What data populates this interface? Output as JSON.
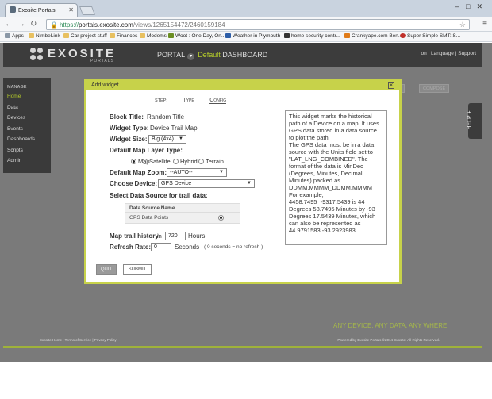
{
  "browser": {
    "tab_title": "Exosite Portals",
    "url_host": "portals.exosite.com",
    "url_path": "/views/1265154472/2460159184",
    "url_scheme": "https://",
    "bookmarks": [
      "Apps",
      "NimbeLink",
      "Car project stuff",
      "Finances",
      "Modems",
      "Woot : One Day, On...",
      "Weather in Plymouth",
      "home security contr...",
      "Crankyape.com Ben...",
      "Super Simple SMT: S..."
    ]
  },
  "header": {
    "logo_text": "EXOSITE",
    "logo_sub": "PORTALS",
    "portal_label": "PORTAL",
    "default_label": "Default",
    "dashboard_label": "DASHBOARD",
    "right_user": "on",
    "right_language": "| Language",
    "right_support": "| Support"
  },
  "sidebar": {
    "section": "MANAGE",
    "items": [
      {
        "label": "Home",
        "active": true
      },
      {
        "label": "Data"
      },
      {
        "label": "Devices"
      },
      {
        "label": "Events"
      },
      {
        "label": "Dashboards"
      },
      {
        "label": "Scripts"
      },
      {
        "label": "Admin"
      }
    ]
  },
  "background_buttons": {
    "compose": "COMPOSE"
  },
  "help_tab": "HELP +",
  "tagline": "ANY DEVICE. ANY DATA. ANY WHERE.",
  "footer": {
    "left": "Exosite Home | Terms of Service | Privacy Policy",
    "right": "Powered by Exosite Portals ©2014 Exosite. All Rights Reserved."
  },
  "modal": {
    "title": "Add widget",
    "step_label": "STEP:",
    "steps": [
      {
        "label": "Type"
      },
      {
        "label": "Config",
        "active": true
      }
    ],
    "block_title_label": "Block Title:",
    "block_title_value": "Random Title",
    "widget_type_label": "Widget Type:",
    "widget_type_value": "Device Trail Map",
    "widget_size_label": "Widget Size:",
    "widget_size_value": "Big (4x4)",
    "map_layer_label": "Default Map Layer Type:",
    "map_layers": [
      {
        "label": "Map",
        "selected": true
      },
      {
        "label": "Satellite"
      },
      {
        "label": "Hybrid"
      },
      {
        "label": "Terrain"
      }
    ],
    "map_zoom_label": "Default Map Zoom:",
    "map_zoom_value": "--AUTO--",
    "device_label": "Choose Device:",
    "device_value": "GPS Device",
    "datasource_label": "Select Data Source for trail data:",
    "datasource_header": "Data Source Name",
    "datasource_row": "GPS Data Points",
    "trail_history_label": "Map trail history",
    "trail_history_in": "in",
    "trail_history_value": "720",
    "trail_history_unit": "Hours",
    "refresh_label": "Refresh Rate:",
    "refresh_value": "0",
    "refresh_unit": "Seconds",
    "refresh_hint": "( 0 seconds = no refresh )",
    "info_paragraphs": [
      "This widget marks the historical path of a Device on a map. It uses GPS data stored in a data source to plot the path.",
      "The GPS data must be in a data source with the Units field set to \"LAT_LNG_COMBINED\". The format of the data is MinDec (Degrees, Minutes, Decimal Minutes) packed as DDMM.MMMM_DDMM.MMMM",
      "For example, 4458.7495_-9317.5439 is 44 Degrees 58.7495 Minutes by -93 Degrees 17.5439 Minutes, which can also be represented as 44.9791583,-93.2923983"
    ],
    "quit_label": "QUIT",
    "submit_label": "SUBMIT"
  },
  "colors": {
    "accent_green": "#c7d24a",
    "header_dark": "#3c3c3c",
    "overlay_grey": "#7a7a7a"
  }
}
